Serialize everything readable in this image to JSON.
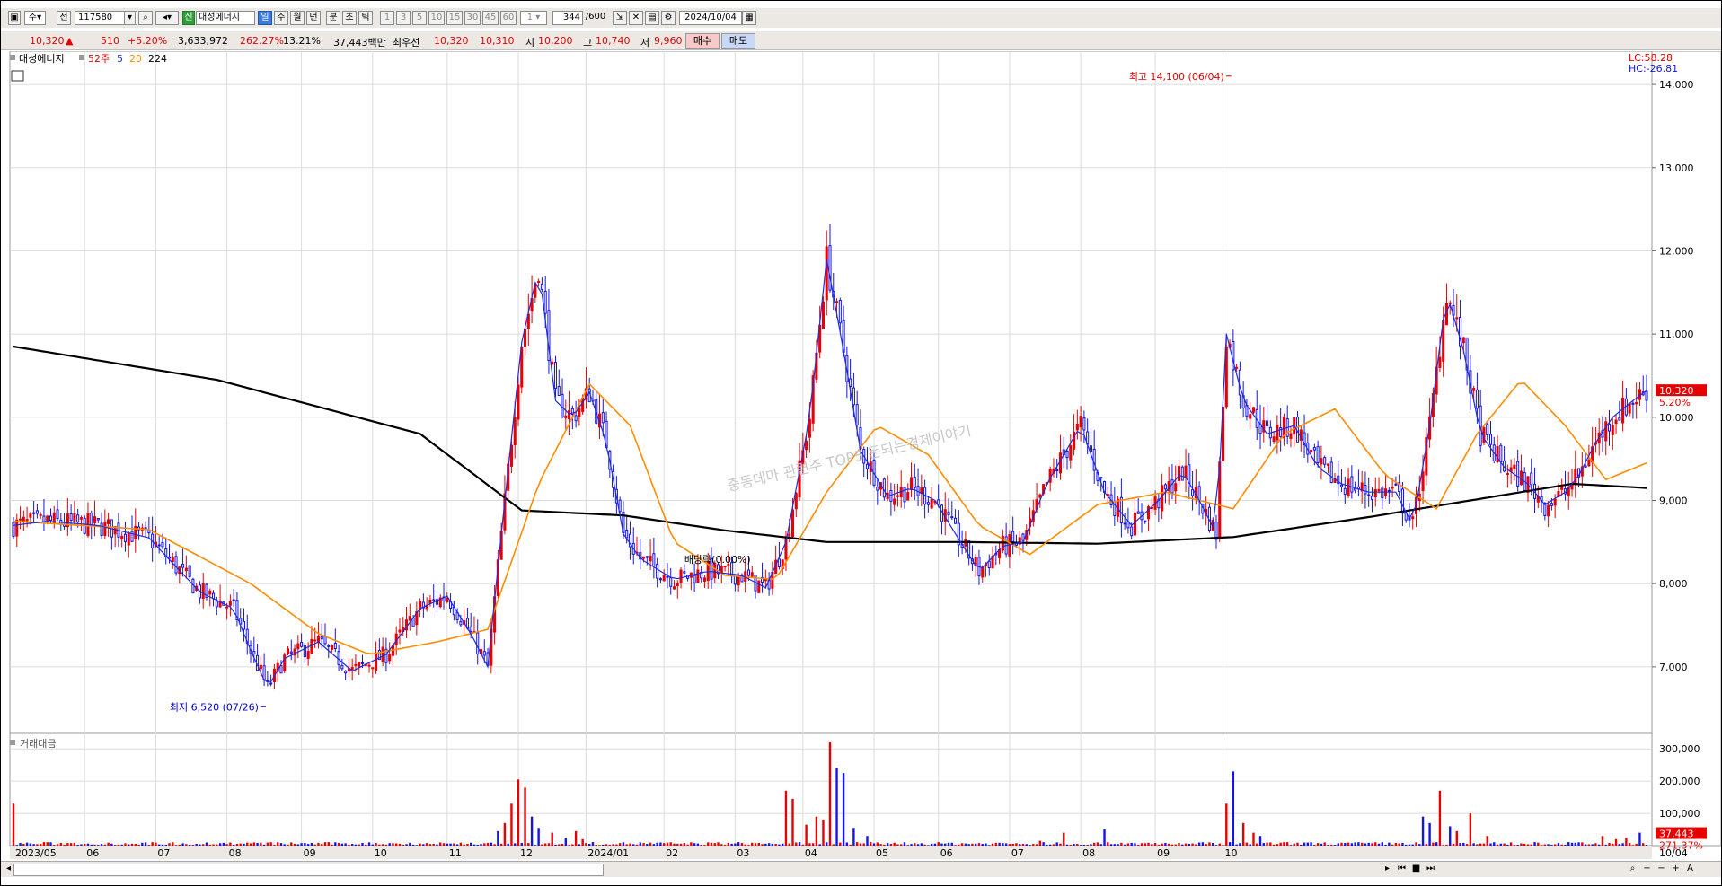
{
  "toolbar": {
    "market": "주",
    "market2": "전",
    "code": "117580",
    "stock_name": "대성에너지",
    "badge": "신",
    "periods": [
      "일",
      "주",
      "월",
      "년",
      "분",
      "초",
      "틱"
    ],
    "active_period": "일",
    "intervals": [
      "1",
      "3",
      "5",
      "10",
      "15",
      "30",
      "45",
      "60"
    ],
    "count_select": "1",
    "bars": "344",
    "bars_max": "/600",
    "date": "2024/10/04"
  },
  "info": {
    "price": "10,320",
    "up_arrow": "▲",
    "change": "510",
    "change_pct": "+5.20%",
    "volume": "3,633,972",
    "vol_ratio": "262.27%",
    "turnover": "13.21%",
    "trade_amount": "37,443백만",
    "best_ask_label": "최우선",
    "best_ask": "10,320",
    "best_bid": "10,310",
    "open_label": "시",
    "open": "10,200",
    "high_label": "고",
    "high": "10,740",
    "low_label": "저",
    "low": "9,960",
    "buy": "매수",
    "sell": "매도"
  },
  "legend": {
    "name": "대성에너지",
    "w52": "52주",
    "ma5": "5",
    "ma20": "20",
    "ma224": "224"
  },
  "colors": {
    "up": "#e60000",
    "down": "#1414e6",
    "ma5": "#1e2ddc",
    "ma20": "#ff8c00",
    "ma224": "#000000",
    "grid": "#dcdcdc"
  },
  "annotations": {
    "high": "최고 14,100 (06/04)",
    "low": "최저 6,520 (07/26)",
    "ex_div": "배당락(0.00%)",
    "watermark": "중동테마 관련주 TOP5 돈되는경제이야기",
    "lc": "LC:58.28",
    "hc": "HC:-26.81",
    "price_tag": "10,320",
    "price_tag_pct": "5.20%",
    "vol_tag": "37,443",
    "vol_tag_pct": "271.37%",
    "vol_title": "거래대금"
  },
  "chart_data": {
    "type": "candlestick",
    "title": "대성에너지",
    "ylim": [
      6200,
      14400
    ],
    "y_ticks": [
      "7,000",
      "8,000",
      "9,000",
      "10,000",
      "11,000",
      "12,000",
      "13,000",
      "14,000"
    ],
    "y_tick_values": [
      7000,
      8000,
      9000,
      10000,
      11000,
      12000,
      13000,
      14000
    ],
    "x_labels": [
      "2023/05",
      "06",
      "07",
      "08",
      "09",
      "10",
      "11",
      "12",
      "2024/01",
      "02",
      "03",
      "04",
      "05",
      "06",
      "07",
      "08",
      "09",
      "10",
      "10/04"
    ],
    "n_bars": 344,
    "price_key_points": [
      [
        0,
        8700
      ],
      [
        10,
        8750
      ],
      [
        25,
        8700
      ],
      [
        40,
        8550
      ],
      [
        55,
        7900
      ],
      [
        65,
        7700
      ],
      [
        70,
        7200
      ],
      [
        75,
        6750
      ],
      [
        80,
        7100
      ],
      [
        90,
        7300
      ],
      [
        100,
        6950
      ],
      [
        110,
        7150
      ],
      [
        120,
        7700
      ],
      [
        128,
        7850
      ],
      [
        135,
        7400
      ],
      [
        140,
        7000
      ],
      [
        144,
        8600
      ],
      [
        150,
        10900
      ],
      [
        155,
        11800
      ],
      [
        160,
        10200
      ],
      [
        165,
        10000
      ],
      [
        170,
        10300
      ],
      [
        175,
        9700
      ],
      [
        180,
        8600
      ],
      [
        185,
        8300
      ],
      [
        195,
        8050
      ],
      [
        205,
        8150
      ],
      [
        215,
        8100
      ],
      [
        222,
        7950
      ],
      [
        228,
        8500
      ],
      [
        235,
        10000
      ],
      [
        240,
        11900
      ],
      [
        245,
        10800
      ],
      [
        250,
        9600
      ],
      [
        258,
        9050
      ],
      [
        265,
        9150
      ],
      [
        272,
        9000
      ],
      [
        278,
        8600
      ],
      [
        285,
        8150
      ],
      [
        292,
        8450
      ],
      [
        298,
        8500
      ],
      [
        305,
        9200
      ],
      [
        315,
        9900
      ],
      [
        322,
        9100
      ],
      [
        330,
        8700
      ],
      [
        338,
        9000
      ],
      [
        345,
        9350
      ],
      [
        350,
        9000
      ],
      [
        355,
        8600
      ],
      [
        358,
        11000
      ],
      [
        363,
        10200
      ],
      [
        370,
        9800
      ],
      [
        378,
        9900
      ],
      [
        385,
        9400
      ],
      [
        392,
        9200
      ],
      [
        400,
        9100
      ],
      [
        408,
        9100
      ],
      [
        413,
        8700
      ],
      [
        418,
        9900
      ],
      [
        423,
        11500
      ],
      [
        428,
        10800
      ],
      [
        433,
        9800
      ],
      [
        440,
        9400
      ],
      [
        447,
        9200
      ],
      [
        452,
        8950
      ],
      [
        458,
        9100
      ],
      [
        462,
        9300
      ],
      [
        467,
        9700
      ],
      [
        472,
        10000
      ],
      [
        478,
        10200
      ],
      [
        482,
        10320
      ]
    ],
    "ma224_key_points": [
      [
        0,
        10850
      ],
      [
        60,
        10450
      ],
      [
        120,
        9800
      ],
      [
        150,
        8880
      ],
      [
        180,
        8820
      ],
      [
        210,
        8640
      ],
      [
        240,
        8500
      ],
      [
        280,
        8500
      ],
      [
        320,
        8480
      ],
      [
        360,
        8560
      ],
      [
        400,
        8800
      ],
      [
        430,
        9000
      ],
      [
        460,
        9200
      ],
      [
        482,
        9150
      ]
    ],
    "ma20_key_points": [
      [
        0,
        8750
      ],
      [
        40,
        8650
      ],
      [
        70,
        8000
      ],
      [
        90,
        7400
      ],
      [
        105,
        7150
      ],
      [
        125,
        7300
      ],
      [
        140,
        7450
      ],
      [
        155,
        9200
      ],
      [
        170,
        10400
      ],
      [
        182,
        9900
      ],
      [
        195,
        8500
      ],
      [
        210,
        8100
      ],
      [
        225,
        8050
      ],
      [
        240,
        9100
      ],
      [
        255,
        9900
      ],
      [
        270,
        9550
      ],
      [
        285,
        8700
      ],
      [
        300,
        8350
      ],
      [
        320,
        8950
      ],
      [
        340,
        9100
      ],
      [
        360,
        8900
      ],
      [
        375,
        9800
      ],
      [
        390,
        10100
      ],
      [
        405,
        9300
      ],
      [
        420,
        8900
      ],
      [
        432,
        9800
      ],
      [
        445,
        10450
      ],
      [
        458,
        9900
      ],
      [
        470,
        9250
      ],
      [
        482,
        9450
      ]
    ],
    "annotations": [
      {
        "text": "최고 14,100 (06/04)",
        "x": 360,
        "y": 14100
      },
      {
        "text": "최저 6,520 (07/26)",
        "x": 75,
        "y": 6520
      }
    ],
    "volume": {
      "title": "거래대금",
      "ylim": [
        0,
        320000
      ],
      "y_ticks": [
        "100,000",
        "200,000",
        "300,000"
      ],
      "y_tick_values": [
        100000,
        200000,
        300000
      ],
      "spikes": [
        [
          0,
          130000
        ],
        [
          143,
          45000
        ],
        [
          145,
          70000
        ],
        [
          147,
          130000
        ],
        [
          149,
          205000
        ],
        [
          151,
          180000
        ],
        [
          153,
          90000
        ],
        [
          155,
          55000
        ],
        [
          159,
          40000
        ],
        [
          163,
          22000
        ],
        [
          166,
          45000
        ],
        [
          168,
          20000
        ],
        [
          228,
          170000
        ],
        [
          230,
          145000
        ],
        [
          234,
          65000
        ],
        [
          237,
          90000
        ],
        [
          239,
          80000
        ],
        [
          241,
          320000
        ],
        [
          243,
          240000
        ],
        [
          245,
          225000
        ],
        [
          248,
          55000
        ],
        [
          252,
          30000
        ],
        [
          303,
          15000
        ],
        [
          310,
          40000
        ],
        [
          322,
          50000
        ],
        [
          358,
          130000
        ],
        [
          360,
          230000
        ],
        [
          363,
          70000
        ],
        [
          366,
          40000
        ],
        [
          368,
          30000
        ],
        [
          416,
          90000
        ],
        [
          418,
          70000
        ],
        [
          421,
          170000
        ],
        [
          424,
          60000
        ],
        [
          426,
          45000
        ],
        [
          430,
          100000
        ],
        [
          435,
          30000
        ],
        [
          469,
          30000
        ],
        [
          473,
          20000
        ],
        [
          476,
          25000
        ],
        [
          480,
          40000
        ]
      ]
    },
    "last_price": 10320,
    "last_volume": 37443
  }
}
